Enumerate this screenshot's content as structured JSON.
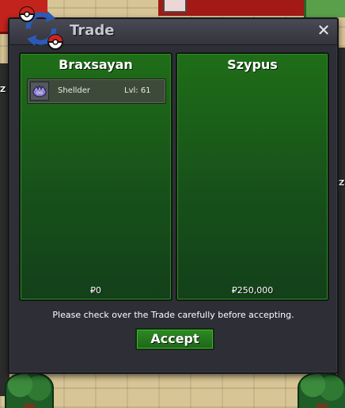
{
  "window": {
    "title": "Trade",
    "close_glyph": "✕"
  },
  "traders": [
    {
      "name": "Braxsayan",
      "money": "₽0",
      "items": [
        {
          "name": "Shellder",
          "level": "Lvl: 61",
          "icon": "shellder-icon"
        }
      ]
    },
    {
      "name": "Szypus",
      "money": "₽250,000",
      "items": []
    }
  ],
  "notice": "Please check over the Trade carefully before accepting.",
  "accept_label": "Accept",
  "colors": {
    "panel_green": "#1f6e18",
    "window_bg": "#2e2e37",
    "accept_green": "#2f8a25"
  }
}
